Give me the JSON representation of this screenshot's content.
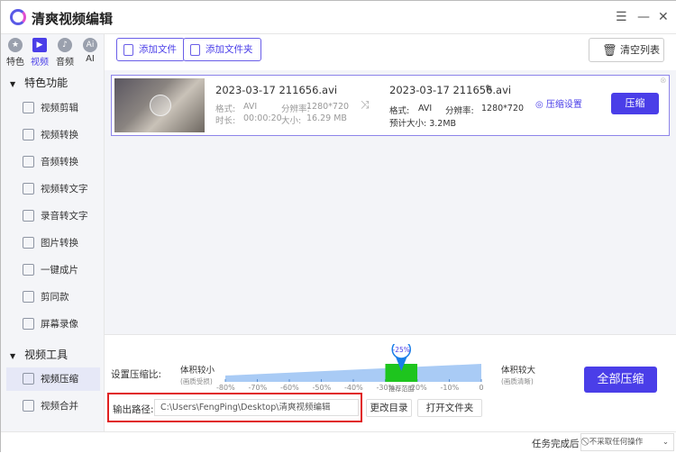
{
  "app": {
    "title": "清爽视频编辑"
  },
  "categories": [
    {
      "label": "特色",
      "icon": "star-icon"
    },
    {
      "label": "视频",
      "icon": "video-icon",
      "active": true
    },
    {
      "label": "音频",
      "icon": "music-icon"
    },
    {
      "label": "AI",
      "icon": "ai-icon"
    }
  ],
  "sidebar": {
    "section1": "特色功能",
    "items1": [
      "视频剪辑",
      "视频转换",
      "音频转换",
      "视频转文字",
      "录音转文字",
      "图片转换",
      "一键成片",
      "剪同款",
      "屏幕录像"
    ],
    "section2": "视频工具",
    "items2": [
      "视频压缩",
      "视频合并"
    ]
  },
  "toolbar": {
    "add_file": "添加文件",
    "add_folder": "添加文件夹",
    "clear_list": "清空列表"
  },
  "file": {
    "source": {
      "name": "2023-03-17 211656.avi",
      "format_label": "格式:",
      "format": "AVI",
      "resolution_label": "分辨率:",
      "resolution": "1280*720",
      "duration_label": "时长:",
      "duration": "00:00:20",
      "size_label": "大小:",
      "size": "16.29 MB"
    },
    "output": {
      "name": "2023-03-17 211656.avi",
      "format_label": "格式:",
      "format": "AVI",
      "resolution_label": "分辨率:",
      "resolution": "1280*720",
      "est_size": "预计大小: 3.2MB"
    },
    "settings_label": "压缩设置",
    "compress_label": "压缩"
  },
  "compression": {
    "label": "设置压缩比:",
    "left_label": "体积较小",
    "left_sub": "(画质受损)",
    "right_label": "体积较大",
    "right_sub": "(画质清晰)",
    "ticks": [
      "-80%",
      "-70%",
      "-60%",
      "-50%",
      "-40%",
      "-30%",
      "-20%",
      "-10%",
      "0"
    ],
    "value": "-25%",
    "value_percent": -25,
    "recommended": "推荐范围",
    "recommended_range": [
      -30,
      -20
    ],
    "compress_all": "全部压缩"
  },
  "output_path": {
    "label": "输出路径:",
    "value": "C:\\Users\\FengPing\\Desktop\\清爽视频编辑",
    "change_dir": "更改目录",
    "open_folder": "打开文件夹"
  },
  "status": {
    "after_label": "任务完成后",
    "after_value": "不采取任何操作"
  },
  "colors": {
    "accent": "#4a3ee8",
    "highlight_box": "#e02020",
    "recommended": "#1ec51e"
  }
}
